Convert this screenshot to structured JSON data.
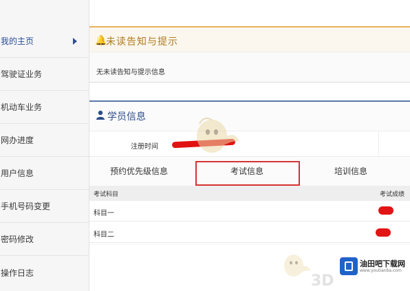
{
  "sidebar": {
    "items": [
      {
        "label": "我的主页",
        "active": true
      },
      {
        "label": "驾驶证业务",
        "active": false
      },
      {
        "label": "机动车业务",
        "active": false
      },
      {
        "label": "网办进度",
        "active": false
      },
      {
        "label": "用户信息",
        "active": false
      },
      {
        "label": "手机号码变更",
        "active": false
      },
      {
        "label": "密码修改",
        "active": false
      },
      {
        "label": "操作日志",
        "active": false
      }
    ]
  },
  "notice": {
    "icon": "bell-icon",
    "title": "未读告知与提示",
    "body": "无未读告知与提示信息"
  },
  "student": {
    "icon": "user-icon",
    "title": "学员信息",
    "reg_label": "注册时间"
  },
  "tabs": {
    "priority": "预约优先级信息",
    "exam": "考试信息",
    "training": "培训信息"
  },
  "exam_table": {
    "headers": {
      "subject": "考试科目",
      "score": "考试成绩"
    },
    "rows": [
      {
        "subject": "科目一"
      },
      {
        "subject": "科目二"
      }
    ]
  },
  "watermark": {
    "label_3d": "3D",
    "brand": "油田吧下载网",
    "brand_sub": "www.youtianba.com"
  },
  "colors": {
    "notice_accent": "#e7b25a",
    "student_accent": "#5b77a8",
    "highlight_red": "#d63232",
    "redaction_red": "#e11212"
  }
}
